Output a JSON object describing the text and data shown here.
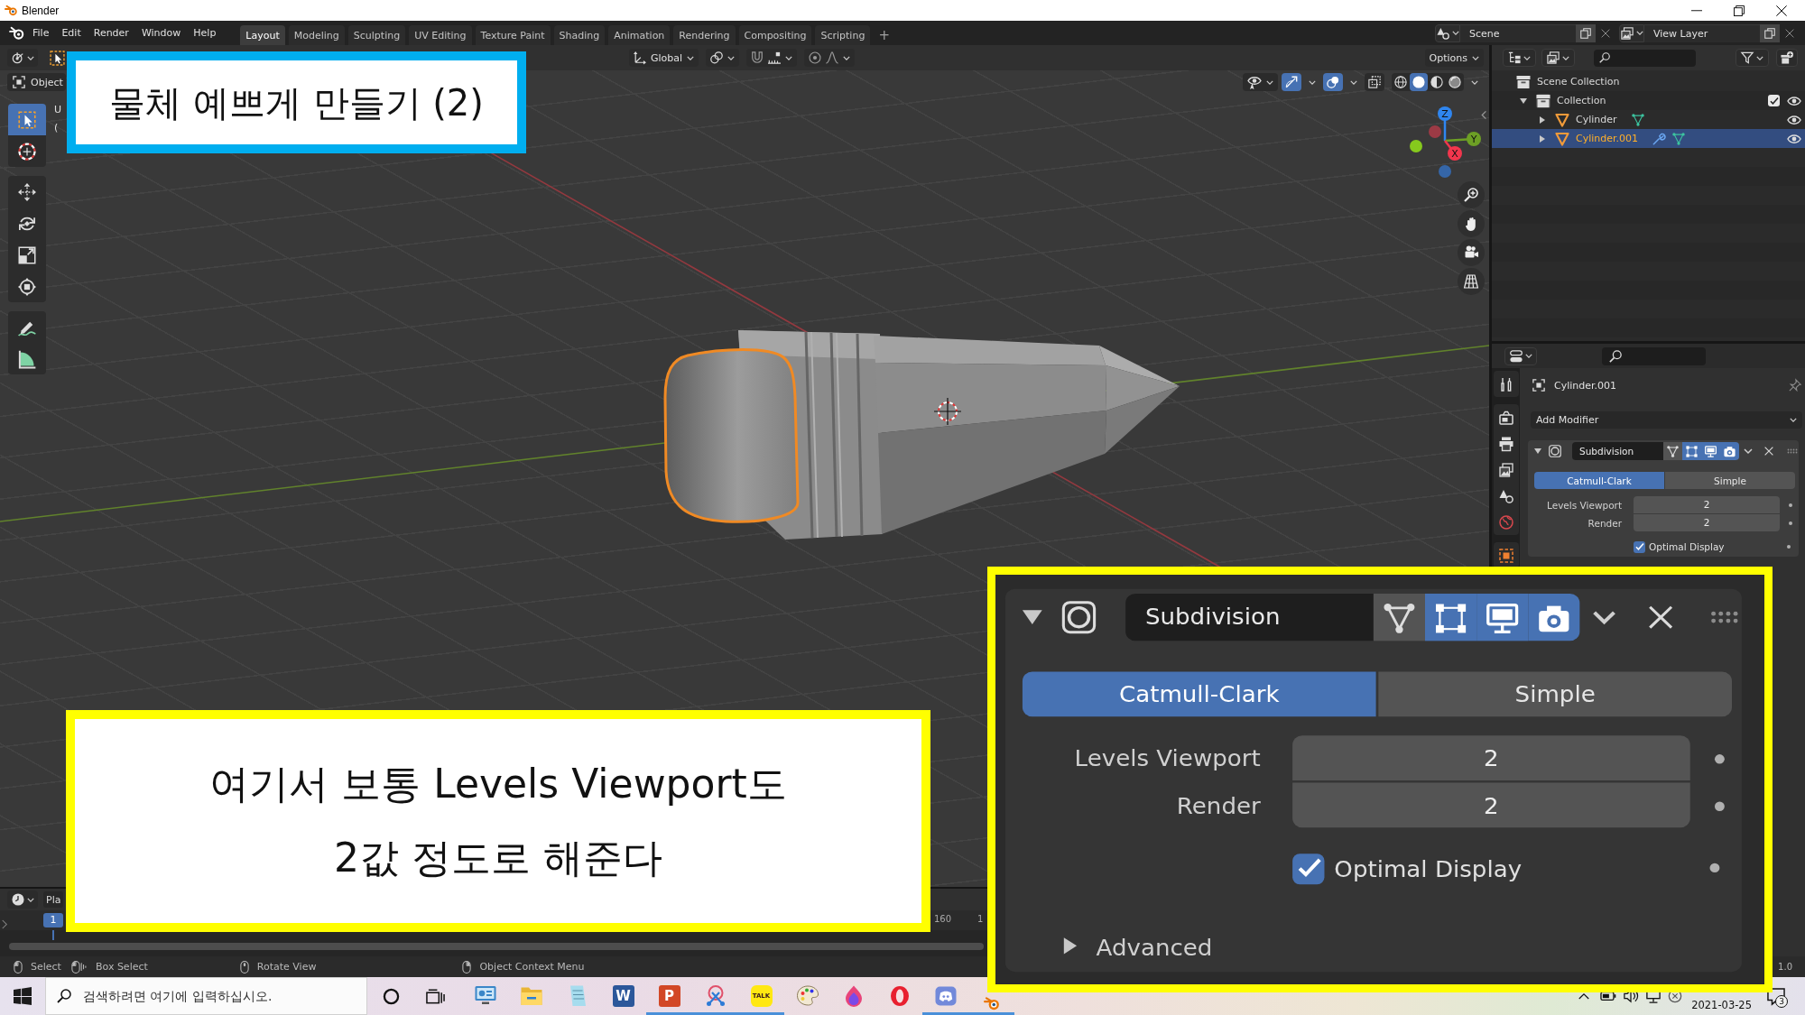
{
  "window": {
    "title": "Blender"
  },
  "top_bar": {
    "menus": [
      "File",
      "Edit",
      "Render",
      "Window",
      "Help"
    ],
    "workspaces": [
      {
        "label": "Layout",
        "selected": true
      },
      {
        "label": "Modeling",
        "selected": false
      },
      {
        "label": "Sculpting",
        "selected": false
      },
      {
        "label": "UV Editing",
        "selected": false
      },
      {
        "label": "Texture Paint",
        "selected": false
      },
      {
        "label": "Shading",
        "selected": false
      },
      {
        "label": "Animation",
        "selected": false
      },
      {
        "label": "Rendering",
        "selected": false
      },
      {
        "label": "Compositing",
        "selected": false
      },
      {
        "label": "Scripting",
        "selected": false
      }
    ],
    "add_workspace": "+",
    "scene": "Scene",
    "view_layer": "View Layer"
  },
  "viewport": {
    "orientation": "Global",
    "options": "Options",
    "mode": "Object",
    "overlay_text": [
      "U",
      "("
    ],
    "tools": [
      {
        "kind": "select-box",
        "selected": true
      },
      {
        "kind": "cursor",
        "selected": false
      },
      {
        "kind": "move",
        "selected": false
      },
      {
        "kind": "rotate",
        "selected": false
      },
      {
        "kind": "scale",
        "selected": false
      },
      {
        "kind": "transform",
        "selected": false
      },
      {
        "kind": "annotate",
        "selected": false
      },
      {
        "kind": "measure",
        "selected": false
      }
    ],
    "toggles": [
      {
        "kind": "gizmos",
        "on": true
      },
      {
        "kind": "overlays",
        "on": true
      },
      {
        "kind": "xray",
        "on": false
      }
    ],
    "shading": [
      {
        "kind": "wireframe",
        "selected": false
      },
      {
        "kind": "solid",
        "selected": true
      },
      {
        "kind": "material",
        "selected": false
      },
      {
        "kind": "rendered",
        "selected": false
      }
    ],
    "gizmo_axes": [
      "Z",
      "Y",
      "X"
    ]
  },
  "timeline": {
    "playback_menu": "Pla",
    "current_frame": "1",
    "frame_labels": [
      "160",
      "1"
    ]
  },
  "outliner": {
    "tree": [
      {
        "label": "Scene Collection",
        "kind": "scene",
        "children": [
          {
            "label": "Collection",
            "kind": "collection",
            "expanded": true,
            "checked": true,
            "visible": true,
            "children": [
              {
                "label": "Cylinder",
                "kind": "mesh-object",
                "expanded": false,
                "selected": false,
                "visible": true,
                "has_modifiers": false
              },
              {
                "label": "Cylinder.001",
                "kind": "mesh-object",
                "expanded": false,
                "selected": true,
                "visible": true,
                "has_modifiers": true
              }
            ]
          }
        ]
      }
    ]
  },
  "properties": {
    "tabs": [
      {
        "kind": "tool",
        "selected": false
      },
      {
        "kind": "render",
        "selected": false
      },
      {
        "kind": "output",
        "selected": false
      },
      {
        "kind": "view-layer",
        "selected": false
      },
      {
        "kind": "scene",
        "selected": false
      },
      {
        "kind": "world",
        "selected": false
      },
      {
        "kind": "object",
        "selected": false
      }
    ],
    "object_name": "Cylinder.001",
    "add_modifier": "Add Modifier",
    "modifier": {
      "name": "Subdivision",
      "expanded": true,
      "toggles": [
        {
          "kind": "edit-mode",
          "on": false
        },
        {
          "kind": "on-cage",
          "on": true
        },
        {
          "kind": "viewport",
          "on": true
        },
        {
          "kind": "render",
          "on": true
        }
      ],
      "methods": [
        {
          "label": "Catmull-Clark",
          "selected": true
        },
        {
          "label": "Simple",
          "selected": false
        }
      ],
      "fields": [
        {
          "label": "Levels Viewport",
          "value": "2"
        },
        {
          "label": "Render",
          "value": "2"
        }
      ],
      "optimal_display": {
        "label": "Optimal Display",
        "checked": true
      }
    }
  },
  "annotations": [
    {
      "color": "#00aeef",
      "lines": [
        "물체 예쁘게 만들기 (2)"
      ]
    },
    {
      "color": "#ffff00",
      "lines": [
        "여기서 보통 Levels Viewport도",
        "2값 정도로 해준다"
      ]
    }
  ],
  "zoom_inset": {
    "modifier": {
      "name": "Subdivision",
      "expanded": true,
      "toggles": [
        {
          "kind": "edit-mode",
          "on": false
        },
        {
          "kind": "on-cage",
          "on": true
        },
        {
          "kind": "viewport",
          "on": true
        },
        {
          "kind": "render",
          "on": true
        }
      ],
      "methods": [
        {
          "label": "Catmull-Clark",
          "selected": true
        },
        {
          "label": "Simple",
          "selected": false
        }
      ],
      "fields": [
        {
          "label": "Levels Viewport",
          "value": "2"
        },
        {
          "label": "Render",
          "value": "2"
        }
      ],
      "optimal_display": {
        "label": "Optimal Display",
        "checked": true
      },
      "advanced": {
        "label": "Advanced",
        "expanded": false
      }
    }
  },
  "status_bar": {
    "hints": [
      {
        "kind": "left-click",
        "label": "Select"
      },
      {
        "kind": "left-drag",
        "label": "Box Select"
      },
      {
        "kind": "middle-drag",
        "label": "Rotate View"
      },
      {
        "kind": "right-click",
        "label": "Object Context Menu"
      }
    ],
    "version": "1.0"
  },
  "taskbar": {
    "search_placeholder": "검색하려면 여기에 입력하십시오.",
    "apps": [
      {
        "kind": "control-panel",
        "running": false
      },
      {
        "kind": "file-explorer",
        "running": false
      },
      {
        "kind": "notepad",
        "running": false
      },
      {
        "kind": "word",
        "label": "W",
        "running": false
      },
      {
        "kind": "powerpoint",
        "label": "P",
        "running": true
      },
      {
        "kind": "snipping",
        "running": true
      },
      {
        "kind": "kakaotalk",
        "label": "TALK",
        "running": true
      },
      {
        "kind": "paint",
        "running": false
      },
      {
        "kind": "droplet",
        "running": false
      },
      {
        "kind": "opera",
        "running": false
      },
      {
        "kind": "discord",
        "running": true
      },
      {
        "kind": "blender",
        "running": true
      }
    ],
    "date": "2021-03-25",
    "notifications": "3"
  }
}
